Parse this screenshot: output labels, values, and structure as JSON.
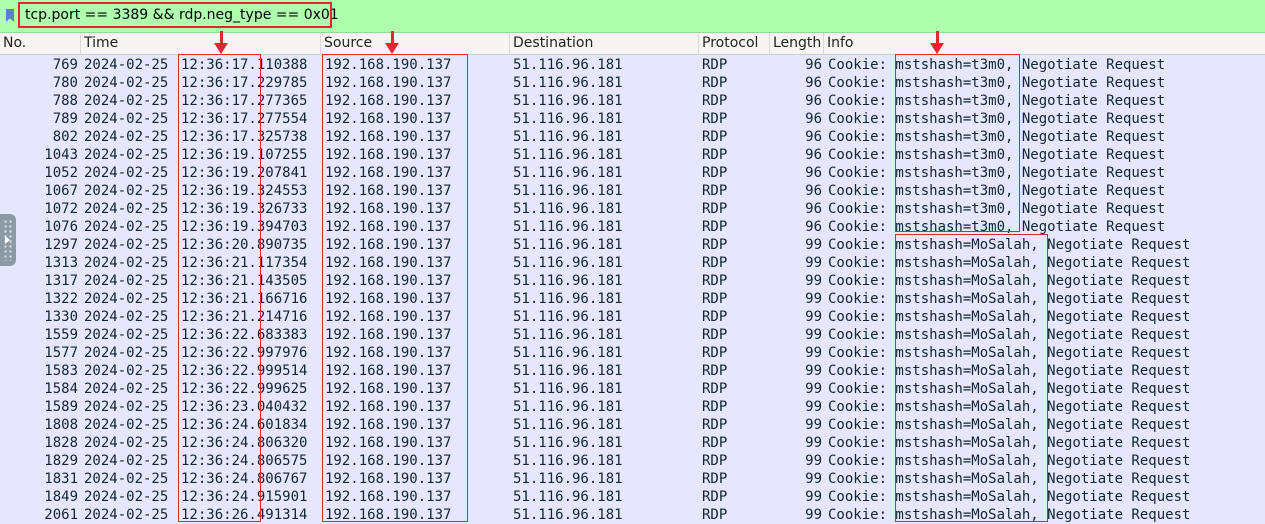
{
  "filter": {
    "expression": "tcp.port == 3389 && rdp.neg_type == 0x01",
    "bookmark_icon": "bookmark-icon"
  },
  "columns": [
    "No.",
    "Time",
    "Source",
    "Destination",
    "Protocol",
    "Length",
    "Info"
  ],
  "colors": {
    "filter_bg": "#afffaf",
    "row_bg": "#e7e6ff",
    "annotation": "#e0282e"
  },
  "rows": [
    {
      "no": "769",
      "date": "2024-02-25",
      "time": "12:36:17.110388",
      "src": "192.168.190.137",
      "dst": "51.116.96.181",
      "proto": "RDP",
      "len": "96",
      "info": "Cookie: mstshash=t3m0, Negotiate Request"
    },
    {
      "no": "780",
      "date": "2024-02-25",
      "time": "12:36:17.229785",
      "src": "192.168.190.137",
      "dst": "51.116.96.181",
      "proto": "RDP",
      "len": "96",
      "info": "Cookie: mstshash=t3m0, Negotiate Request"
    },
    {
      "no": "788",
      "date": "2024-02-25",
      "time": "12:36:17.277365",
      "src": "192.168.190.137",
      "dst": "51.116.96.181",
      "proto": "RDP",
      "len": "96",
      "info": "Cookie: mstshash=t3m0, Negotiate Request"
    },
    {
      "no": "789",
      "date": "2024-02-25",
      "time": "12:36:17.277554",
      "src": "192.168.190.137",
      "dst": "51.116.96.181",
      "proto": "RDP",
      "len": "96",
      "info": "Cookie: mstshash=t3m0, Negotiate Request"
    },
    {
      "no": "802",
      "date": "2024-02-25",
      "time": "12:36:17.325738",
      "src": "192.168.190.137",
      "dst": "51.116.96.181",
      "proto": "RDP",
      "len": "96",
      "info": "Cookie: mstshash=t3m0, Negotiate Request"
    },
    {
      "no": "1043",
      "date": "2024-02-25",
      "time": "12:36:19.107255",
      "src": "192.168.190.137",
      "dst": "51.116.96.181",
      "proto": "RDP",
      "len": "96",
      "info": "Cookie: mstshash=t3m0, Negotiate Request"
    },
    {
      "no": "1052",
      "date": "2024-02-25",
      "time": "12:36:19.207841",
      "src": "192.168.190.137",
      "dst": "51.116.96.181",
      "proto": "RDP",
      "len": "96",
      "info": "Cookie: mstshash=t3m0, Negotiate Request"
    },
    {
      "no": "1067",
      "date": "2024-02-25",
      "time": "12:36:19.324553",
      "src": "192.168.190.137",
      "dst": "51.116.96.181",
      "proto": "RDP",
      "len": "96",
      "info": "Cookie: mstshash=t3m0, Negotiate Request"
    },
    {
      "no": "1072",
      "date": "2024-02-25",
      "time": "12:36:19.326733",
      "src": "192.168.190.137",
      "dst": "51.116.96.181",
      "proto": "RDP",
      "len": "96",
      "info": "Cookie: mstshash=t3m0, Negotiate Request"
    },
    {
      "no": "1076",
      "date": "2024-02-25",
      "time": "12:36:19.394703",
      "src": "192.168.190.137",
      "dst": "51.116.96.181",
      "proto": "RDP",
      "len": "96",
      "info": "Cookie: mstshash=t3m0, Negotiate Request"
    },
    {
      "no": "1297",
      "date": "2024-02-25",
      "time": "12:36:20.890735",
      "src": "192.168.190.137",
      "dst": "51.116.96.181",
      "proto": "RDP",
      "len": "99",
      "info": "Cookie: mstshash=MoSalah, Negotiate Request"
    },
    {
      "no": "1313",
      "date": "2024-02-25",
      "time": "12:36:21.117354",
      "src": "192.168.190.137",
      "dst": "51.116.96.181",
      "proto": "RDP",
      "len": "99",
      "info": "Cookie: mstshash=MoSalah, Negotiate Request"
    },
    {
      "no": "1317",
      "date": "2024-02-25",
      "time": "12:36:21.143505",
      "src": "192.168.190.137",
      "dst": "51.116.96.181",
      "proto": "RDP",
      "len": "99",
      "info": "Cookie: mstshash=MoSalah, Negotiate Request"
    },
    {
      "no": "1322",
      "date": "2024-02-25",
      "time": "12:36:21.166716",
      "src": "192.168.190.137",
      "dst": "51.116.96.181",
      "proto": "RDP",
      "len": "99",
      "info": "Cookie: mstshash=MoSalah, Negotiate Request"
    },
    {
      "no": "1330",
      "date": "2024-02-25",
      "time": "12:36:21.214716",
      "src": "192.168.190.137",
      "dst": "51.116.96.181",
      "proto": "RDP",
      "len": "99",
      "info": "Cookie: mstshash=MoSalah, Negotiate Request"
    },
    {
      "no": "1559",
      "date": "2024-02-25",
      "time": "12:36:22.683383",
      "src": "192.168.190.137",
      "dst": "51.116.96.181",
      "proto": "RDP",
      "len": "99",
      "info": "Cookie: mstshash=MoSalah, Negotiate Request"
    },
    {
      "no": "1577",
      "date": "2024-02-25",
      "time": "12:36:22.997976",
      "src": "192.168.190.137",
      "dst": "51.116.96.181",
      "proto": "RDP",
      "len": "99",
      "info": "Cookie: mstshash=MoSalah, Negotiate Request"
    },
    {
      "no": "1583",
      "date": "2024-02-25",
      "time": "12:36:22.999514",
      "src": "192.168.190.137",
      "dst": "51.116.96.181",
      "proto": "RDP",
      "len": "99",
      "info": "Cookie: mstshash=MoSalah, Negotiate Request"
    },
    {
      "no": "1584",
      "date": "2024-02-25",
      "time": "12:36:22.999625",
      "src": "192.168.190.137",
      "dst": "51.116.96.181",
      "proto": "RDP",
      "len": "99",
      "info": "Cookie: mstshash=MoSalah, Negotiate Request"
    },
    {
      "no": "1589",
      "date": "2024-02-25",
      "time": "12:36:23.040432",
      "src": "192.168.190.137",
      "dst": "51.116.96.181",
      "proto": "RDP",
      "len": "99",
      "info": "Cookie: mstshash=MoSalah, Negotiate Request"
    },
    {
      "no": "1808",
      "date": "2024-02-25",
      "time": "12:36:24.601834",
      "src": "192.168.190.137",
      "dst": "51.116.96.181",
      "proto": "RDP",
      "len": "99",
      "info": "Cookie: mstshash=MoSalah, Negotiate Request"
    },
    {
      "no": "1828",
      "date": "2024-02-25",
      "time": "12:36:24.806320",
      "src": "192.168.190.137",
      "dst": "51.116.96.181",
      "proto": "RDP",
      "len": "99",
      "info": "Cookie: mstshash=MoSalah, Negotiate Request"
    },
    {
      "no": "1829",
      "date": "2024-02-25",
      "time": "12:36:24.806575",
      "src": "192.168.190.137",
      "dst": "51.116.96.181",
      "proto": "RDP",
      "len": "99",
      "info": "Cookie: mstshash=MoSalah, Negotiate Request"
    },
    {
      "no": "1831",
      "date": "2024-02-25",
      "time": "12:36:24.806767",
      "src": "192.168.190.137",
      "dst": "51.116.96.181",
      "proto": "RDP",
      "len": "99",
      "info": "Cookie: mstshash=MoSalah, Negotiate Request"
    },
    {
      "no": "1849",
      "date": "2024-02-25",
      "time": "12:36:24.915901",
      "src": "192.168.190.137",
      "dst": "51.116.96.181",
      "proto": "RDP",
      "len": "99",
      "info": "Cookie: mstshash=MoSalah, Negotiate Request"
    },
    {
      "no": "2061",
      "date": "2024-02-25",
      "time": "12:36:26.491314",
      "src": "192.168.190.137",
      "dst": "51.116.96.181",
      "proto": "RDP",
      "len": "99",
      "info": "Cookie: mstshash=MoSalah, Negotiate Request"
    }
  ]
}
